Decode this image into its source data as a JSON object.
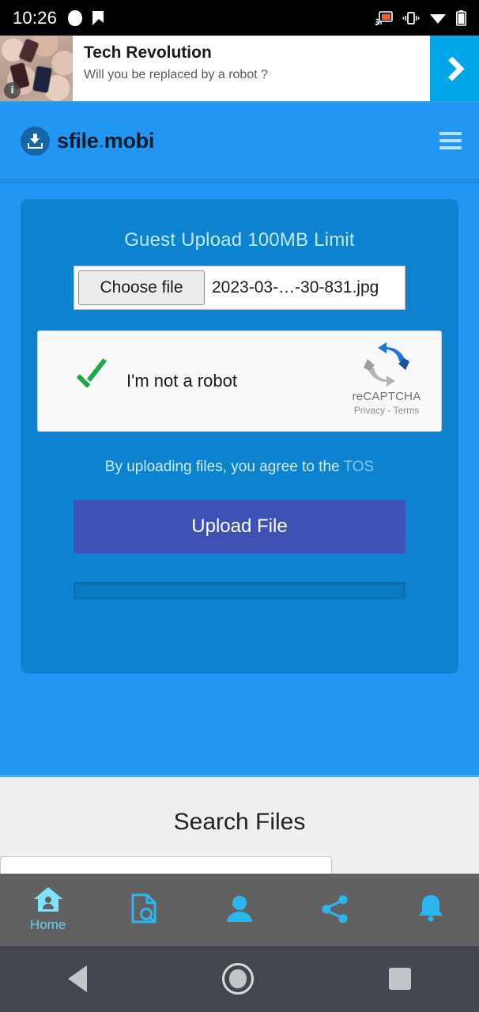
{
  "status_bar": {
    "time": "10:26",
    "icons_left": [
      "record-dot-icon",
      "check-flag-icon"
    ],
    "icons_right": [
      "cast-icon",
      "vibrate-icon",
      "wifi-icon",
      "battery-icon"
    ]
  },
  "ad": {
    "title": "Tech Revolution",
    "subtitle": "Will you be replaced by a robot ?",
    "info_badge": "i",
    "cta_icon": "chevron-right-icon"
  },
  "header": {
    "logo_name": "sfile",
    "logo_dot": ".",
    "logo_tld": "mobi",
    "menu_icon": "hamburger-menu-icon"
  },
  "upload": {
    "title": "Guest Upload 100MB Limit",
    "choose_file_label": "Choose file",
    "file_name": "2023-03-…-30-831.jpg",
    "recaptcha": {
      "label": "I'm not a robot",
      "brand": "reCAPTCHA",
      "links": "Privacy - Terms",
      "checked": true
    },
    "tos_text": "By uploading files, you agree to the ",
    "tos_link": "TOS",
    "submit_label": "Upload File",
    "progress_percent": 0
  },
  "search": {
    "title": "Search Files",
    "placeholder": ""
  },
  "app_nav": [
    {
      "name": "home",
      "label": "Home",
      "icon": "home-person-icon",
      "active": true
    },
    {
      "name": "file-search",
      "label": "",
      "icon": "file-search-icon",
      "active": false
    },
    {
      "name": "account",
      "label": "",
      "icon": "person-icon",
      "active": false
    },
    {
      "name": "share",
      "label": "",
      "icon": "share-icon",
      "active": false
    },
    {
      "name": "notifications",
      "label": "",
      "icon": "bell-icon",
      "active": false
    }
  ],
  "system_nav": {
    "back": "back-triangle-icon",
    "home": "home-circle-icon",
    "recents": "recents-square-icon"
  },
  "colors": {
    "page_blue": "#2196f3",
    "card_blue": "#0d82ce",
    "upload_purple": "#3f51b5",
    "accent_cyan": "#5fd3f5",
    "nav_gray": "#616161"
  }
}
